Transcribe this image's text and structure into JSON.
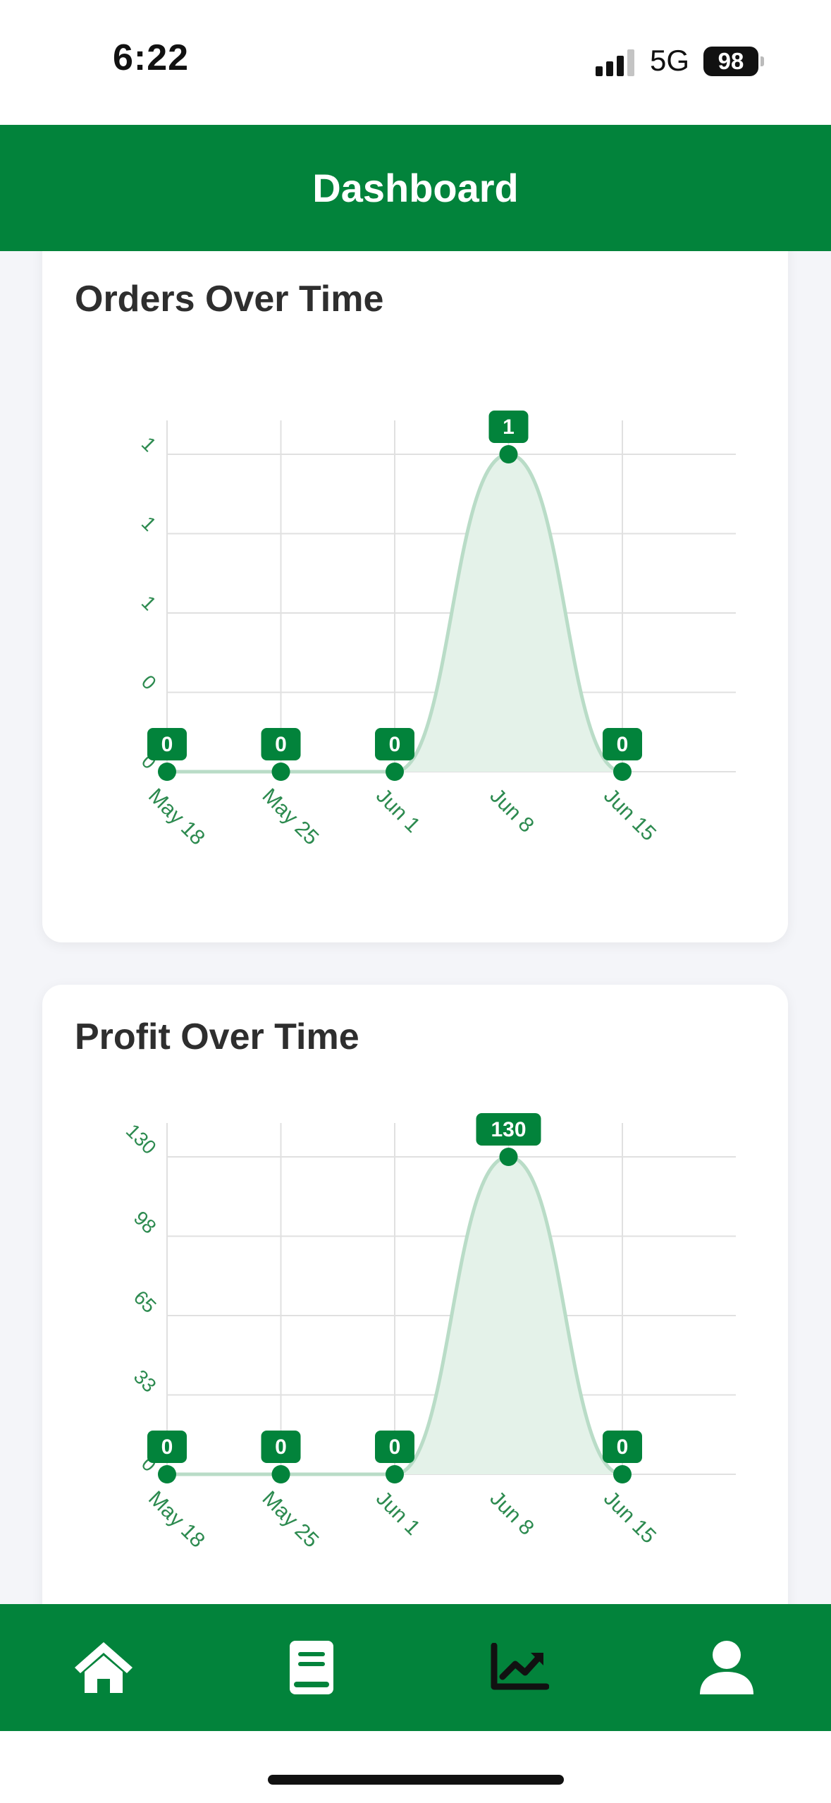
{
  "status": {
    "time": "6:22",
    "network": "5G",
    "battery": "98"
  },
  "header": {
    "title": "Dashboard"
  },
  "colors": {
    "brand": "#02833b",
    "line": "#b9dcc7",
    "fill": "#e4f2e9",
    "grid": "#e0e0e0",
    "label": "#2c8a4f"
  },
  "charts": {
    "orders": {
      "title": "Orders Over Time"
    },
    "profit": {
      "title": "Profit Over Time"
    }
  },
  "chart_data": [
    {
      "type": "area",
      "title": "Orders Over Time",
      "x": [
        "May 18",
        "May 25",
        "Jun 1",
        "Jun 8",
        "Jun 15"
      ],
      "values": [
        0,
        0,
        0,
        1,
        0
      ],
      "data_labels": [
        "0",
        "0",
        "0",
        "1",
        "0"
      ],
      "yticks": [
        "0",
        "0",
        "1",
        "1",
        "1"
      ],
      "ylim": [
        0,
        1
      ],
      "grid": true
    },
    {
      "type": "area",
      "title": "Profit Over Time",
      "x": [
        "May 18",
        "May 25",
        "Jun 1",
        "Jun 8",
        "Jun 15"
      ],
      "values": [
        0,
        0,
        0,
        130,
        0
      ],
      "data_labels": [
        "0",
        "0",
        "0",
        "130",
        "0"
      ],
      "yticks": [
        "0",
        "33",
        "65",
        "98",
        "130"
      ],
      "ylim": [
        0,
        130
      ],
      "grid": true
    }
  ],
  "tabs": [
    {
      "icon": "home-icon",
      "active": false
    },
    {
      "icon": "book-icon",
      "active": false
    },
    {
      "icon": "chart-line-icon",
      "active": true
    },
    {
      "icon": "user-icon",
      "active": false
    }
  ]
}
